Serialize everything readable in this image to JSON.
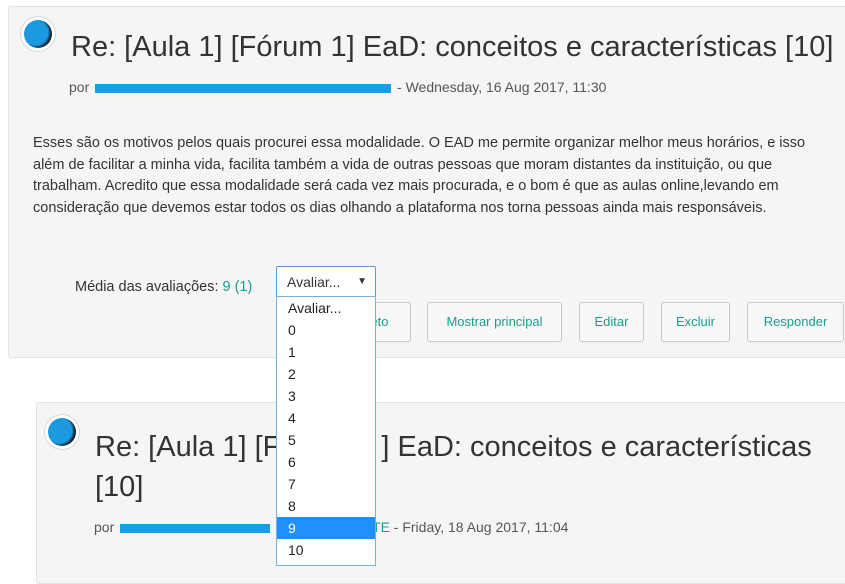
{
  "post1": {
    "subject": "Re: [Aula 1] [Fórum 1] EaD: conceitos e características [10]",
    "by_prefix": "por",
    "date_text": " - Wednesday, 16 Aug 2017, 11:30",
    "body": "Esses são os motivos pelos quais procurei essa modalidade. O EAD me permite organizar melhor meus horários, e isso além de facilitar a minha vida, facilita também a vida de outras pessoas que moram distantes da instituição, ou que trabalham. Acredito que essa modalidade será cada vez mais procurada, e o bom é que as aulas online,levando em consideração que devemos estar todos os dias olhando a plataforma nos torna pessoas ainda mais responsáveis.",
    "rating_label": "Média das avaliações: ",
    "rating_value": "9 (1)",
    "rating_select": "Avaliar...",
    "buttons": {
      "permalink_partial": "eto",
      "show_parent": "Mostrar principal",
      "edit": "Editar",
      "delete": "Excluir",
      "reply": "Responder"
    }
  },
  "post2": {
    "subject": "Re: [Aula 1] [F",
    "subject_tail_line1": "] EaD: conceitos e características",
    "subject_line2": "[10]",
    "by_prefix": "por",
    "author_partial": "TE",
    "date_text": " - Friday, 18 Aug 2017, 11:04"
  },
  "dropdown": {
    "options": [
      "Avaliar...",
      "0",
      "1",
      "2",
      "3",
      "4",
      "5",
      "6",
      "7",
      "8",
      "9",
      "10"
    ],
    "selected": "9"
  },
  "colors": {
    "link": "#1a9d8c",
    "selected_option": "#1e90ff",
    "redaction": "#1a9de6"
  },
  "icons": {
    "avatar": "user-avatar-icon",
    "select_arrow": "caret-down-icon"
  }
}
